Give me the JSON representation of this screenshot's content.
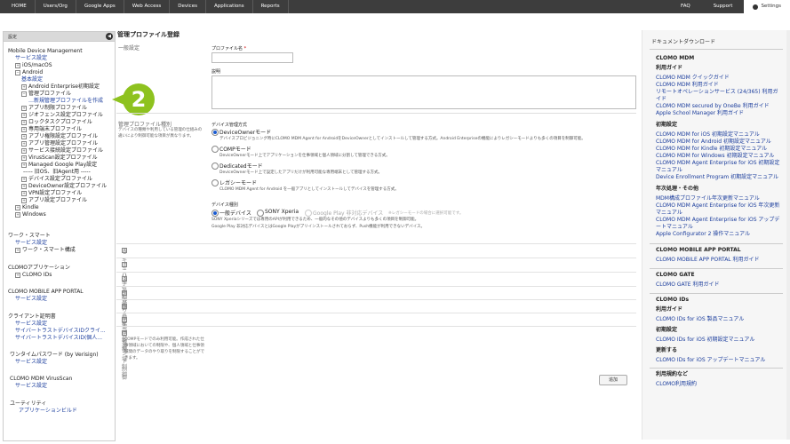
{
  "topnav": {
    "left": [
      "HOME",
      "Users/Org",
      "Google Apps",
      "Web Access",
      "Devices",
      "Applications",
      "Reports"
    ],
    "right": [
      "FAQ",
      "Support"
    ],
    "settings": "Settings"
  },
  "sidebar": {
    "header": "設定",
    "items": [
      "Mobile Device Management",
      "サービス設定",
      "iOS/macOS",
      "Android",
      "基本設定",
      "Android Enterprise初期設定",
      "管理プロファイル",
      "新規管理プロファイルを作成",
      "アプリ制限プロファイル",
      "ジオフェンス設定プロファイル",
      "ロックタスクプロファイル",
      "専用端末プロファイル",
      "アプリ権限設定プロファイル",
      "アプリ管理設定プロファイル",
      "サービス接続設定プロファイル",
      "VirusScan設定プロファイル",
      "Managed Google Play設定",
      "----- 旧OS、旧Agent用 -----",
      "デバイス設定プロファイル",
      "DeviceOwner設定プロファイル",
      "VPN設定プロファイル",
      "アプリ設定プロファイル",
      "Kindle",
      "Windows",
      "ワーク・スマート",
      "サービス設定",
      "ワーク・スマート構成",
      "CLOMOアプリケーション",
      "CLOMO IDs",
      "CLOMO MOBILE APP PORTAL",
      "サービス設定",
      "クライアント証明書",
      "サービス設定",
      "サイバートラストデバイスIDクライ...",
      "サイバートラストデバイスID(個人...",
      "ワンタイムパスワード (by Verisign)",
      "サービス設定",
      "CLOMO MDM VirusScan",
      "サービス設定",
      "ユーティリティ",
      "アプリケーションビルド"
    ]
  },
  "badge": "2",
  "main": {
    "title": "管理プロファイル登録",
    "general": "一般設定",
    "profile_name_label": "プロファイル名",
    "required": "*",
    "desc_label": "説明",
    "type_title": "管理プロファイル種別",
    "type_desc": "デバイスの種類や利用している管理の仕組みの違いにより制御可能な項目が異なります。",
    "device_mgmt_label": "デバイス管理方式",
    "modes": [
      {
        "label": "DeviceOwnerモード",
        "desc": "デバイスプロビジョニング時にCLOMO MDM Agent for AndroidをDeviceOwnerとしてインストールして管理する方式。Android Enterpriseの機能によりレガシーモードよりも多くの項目を制御可能。"
      },
      {
        "label": "COMPモード",
        "desc": "DeviceOwnerモード上でアプリケーションを仕事領域と個人領域に分割して管理できる方式。"
      },
      {
        "label": "Dedicatedモード",
        "desc": "DeviceOwnerモード上で設定したアプリだけが利用可能な専用端末として管理する方式。"
      },
      {
        "label": "レガシーモード",
        "desc": "CLOMO MDM Agent for Android を一般アプリとしてインストールしてデバイスを管理する方式。"
      }
    ],
    "device_type_label": "デバイス種別",
    "device_types": [
      "一般デバイス",
      "SONY Xperia",
      "Google Play 非対応デバイス"
    ],
    "device_type_note": "※レガシーモードの場合に選択可能です。",
    "xperia_note": "SONY Xperiaシリーズでは専用のAPIが利用できるため、一般的なその他のデバイスよりも多くの項目を制御可能。",
    "gplay_note": "Google Play 非対応デバイスとはGoogle Playがプリインストールされておらず、Push機能が利用できないデバイス。",
    "accordions": [
      "セキュリティとプライバシー",
      "デバイス制御",
      "通信制御",
      "アプリ制御",
      "ユーザー制御",
      "エージェント制御",
      "仕事領域制御"
    ],
    "work_desc": "COMPモードでのみ利用可能。作成された仕事領域においての制限や、個人領域と仕事領域間のデータのやり取りを制限することができます。",
    "add_button": "追加"
  },
  "right": {
    "title": "ドキュメントダウンロード",
    "items": [
      {
        "t": "h",
        "text": "CLOMO MDM"
      },
      {
        "t": "h",
        "text": "利用ガイド"
      },
      {
        "t": "l",
        "text": "CLOMO MDM クイックガイド"
      },
      {
        "t": "l",
        "text": "CLOMO MDM 利用ガイド"
      },
      {
        "t": "l",
        "text": "リモートオペレーションサービス (24/365) 利用ガイド"
      },
      {
        "t": "l",
        "text": "CLOMO MDM secured by OneBe 利用ガイド"
      },
      {
        "t": "l",
        "text": "Apple School Manager 利用ガイド"
      },
      {
        "t": "h",
        "text": "初期設定"
      },
      {
        "t": "l",
        "text": "CLOMO MDM for iOS 初期設定マニュアル"
      },
      {
        "t": "l",
        "text": "CLOMO MDM for Android 初期設定マニュアル"
      },
      {
        "t": "l",
        "text": "CLOMO MDM for Kindle 初期設定マニュアル"
      },
      {
        "t": "l",
        "text": "CLOMO MDM for Windows 初期設定マニュアル"
      },
      {
        "t": "l",
        "text": "CLOMO MDM Agent Enterprise for iOS 初期設定マニュアル"
      },
      {
        "t": "l",
        "text": "Device Enrollment Program 初期設定マニュアル"
      },
      {
        "t": "h",
        "text": "年次処理・その他"
      },
      {
        "t": "l",
        "text": "MDM構成プロファイル年次更新マニュアル"
      },
      {
        "t": "l",
        "text": "CLOMO MDM Agent Enterprise for iOS 年次更新マニュアル"
      },
      {
        "t": "l",
        "text": "CLOMO MDM Agent Enterprise for iOS アップデートマニュアル"
      },
      {
        "t": "l",
        "text": "Apple Configurator 2 操作マニュアル"
      },
      {
        "t": "h",
        "text": "CLOMO MOBILE APP PORTAL"
      },
      {
        "t": "l",
        "text": "CLOMO MOBILE APP PORTAL 利用ガイド"
      },
      {
        "t": "h",
        "text": "CLOMO GATE"
      },
      {
        "t": "l",
        "text": "CLOMO GATE 利用ガイド"
      },
      {
        "t": "h",
        "text": "CLOMO IDs"
      },
      {
        "t": "h",
        "text": "利用ガイド"
      },
      {
        "t": "l",
        "text": "CLOMO IDs for iOS 製品マニュアル"
      },
      {
        "t": "h",
        "text": "初期設定"
      },
      {
        "t": "l",
        "text": "CLOMO IDs for iOS 初期設定マニュアル"
      },
      {
        "t": "h",
        "text": "更新する"
      },
      {
        "t": "l",
        "text": "CLOMO IDs for iOS アップデートマニュアル"
      },
      {
        "t": "h",
        "text": "利用規約など"
      },
      {
        "t": "l",
        "text": "CLOMO利用規約"
      }
    ]
  }
}
